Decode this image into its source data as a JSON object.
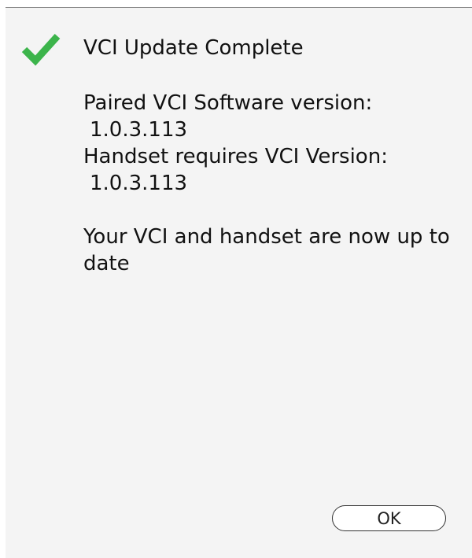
{
  "dialog": {
    "icon": "checkmark-icon",
    "accent_color": "#3cb44b",
    "title": "VCI Update Complete",
    "paired_label": "Paired VCI Software version:",
    "paired_version": "1.0.3.113",
    "required_label": "Handset requires VCI Version:",
    "required_version": "1.0.3.113",
    "message": "Your VCI and handset are now up to date",
    "ok_label": "OK"
  }
}
